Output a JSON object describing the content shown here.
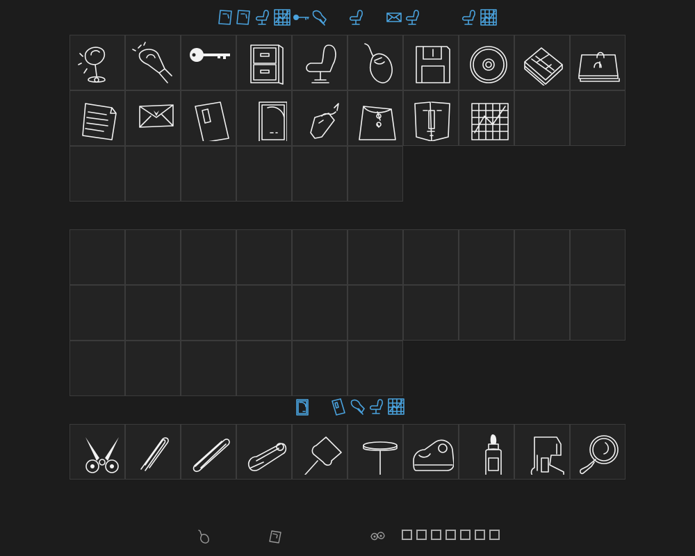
{
  "colors": {
    "background": "#1c1c1c",
    "cell": "#232323",
    "cell_border": "#3b3b3b",
    "icon": "#f2f2f2",
    "collected": "#4aa3df",
    "dim": "#a9a9a9"
  },
  "collected_bar": {
    "icons": [
      "stamp-icon",
      "stamp-icon",
      "chair-icon",
      "chart-icon",
      "key-icon",
      "fan-icon",
      "chair-icon",
      "envelope-icon",
      "chair-icon",
      "chair-icon",
      "chart-icon"
    ]
  },
  "item_grid": {
    "items": [
      "lamp-icon",
      "fan-icon",
      "key-icon",
      "filing-cabinet-icon",
      "chair-icon",
      "mouse-icon",
      "floppy-disk-icon",
      "cd-icon",
      "books-icon",
      "binder-icon",
      "document-icon",
      "envelope-icon",
      "usb-drive-icon",
      "stamp-icon",
      "luggage-tag-icon",
      "seed-packet-icon",
      "folder-icon",
      "chart-icon"
    ],
    "slot_count": 26
  },
  "storage_grid": {
    "slot_count": 26
  },
  "mid_bar": {
    "icons": [
      "stamp-icon",
      "usb-drive-icon",
      "fan-icon",
      "chair-icon",
      "chart-icon"
    ]
  },
  "tool_bar": {
    "items": [
      "scissors-icon",
      "paperclip-icon",
      "paperclip-long-icon",
      "safety-pin-icon",
      "pushpin-icon",
      "nail-icon",
      "tape-dispenser-icon",
      "glue-bottle-icon",
      "stapler-icon",
      "magnifier-icon"
    ]
  },
  "footer": {
    "icons": [
      "mouse-icon",
      "stamp-icon",
      "eyes-icon"
    ],
    "empty_slots": 7
  }
}
